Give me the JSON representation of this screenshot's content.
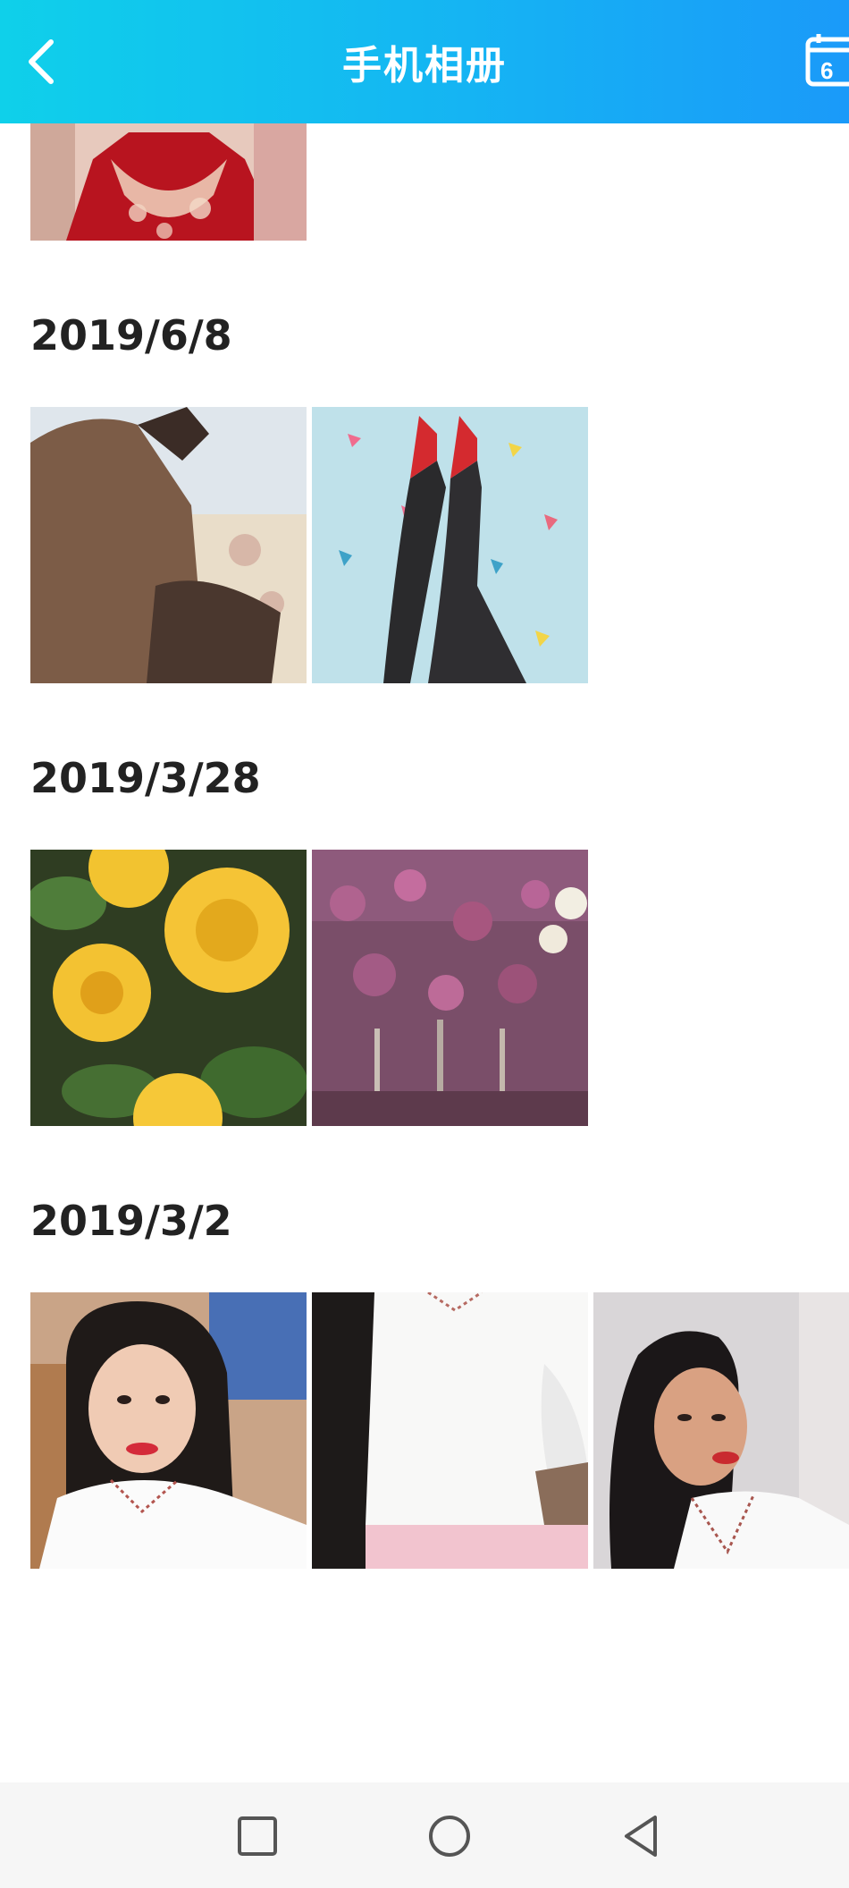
{
  "header": {
    "title": "手机相册",
    "calendar_badge": "6"
  },
  "sections": [
    {
      "date": "2019/6/8"
    },
    {
      "date": "2019/3/28"
    },
    {
      "date": "2019/3/2"
    }
  ],
  "colors": {
    "header_start": "#0fd0ea",
    "header_end": "#1a9af9",
    "date_text": "#222222",
    "navbar_bg": "#f6f6f6"
  },
  "icons": {
    "back": "chevron-left-icon",
    "calendar": "calendar-icon",
    "recent": "square-icon",
    "home": "circle-icon",
    "nav_back": "triangle-back-icon"
  }
}
